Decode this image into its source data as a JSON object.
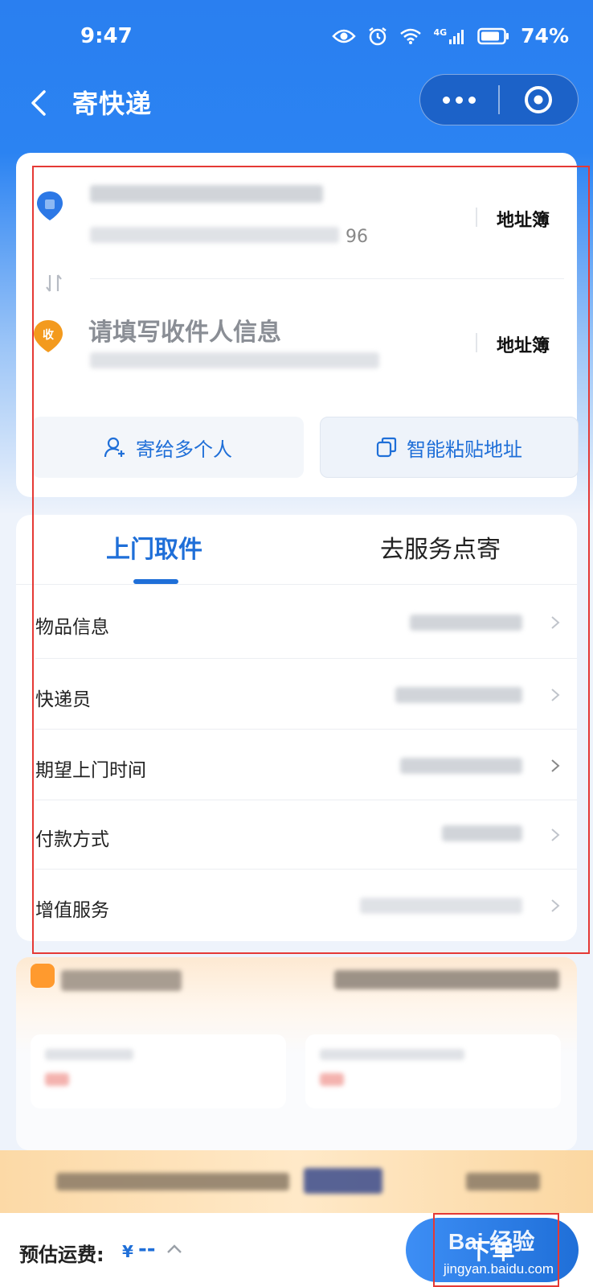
{
  "status_bar": {
    "time": "9:47",
    "network": "4G",
    "battery": "74%"
  },
  "header": {
    "title": "寄快递"
  },
  "sender": {
    "number_suffix": "96",
    "address_book_label": "地址簿"
  },
  "receiver": {
    "placeholder": "请填写收件人信息",
    "badge": "收",
    "address_book_label": "地址簿"
  },
  "actions": {
    "multi_send_label": "寄给多个人",
    "smart_paste_label": "智能粘贴地址"
  },
  "tabs": [
    {
      "label": "上门取件",
      "active": true
    },
    {
      "label": "去服务点寄",
      "active": false
    }
  ],
  "rows": [
    {
      "label": "物品信息"
    },
    {
      "label": "快递员"
    },
    {
      "label": "期望上门时间"
    },
    {
      "label": "付款方式"
    },
    {
      "label": "增值服务"
    }
  ],
  "bottom": {
    "fee_label": "预估运费:",
    "currency": "¥",
    "fee_value": "--",
    "order_label": "下单"
  },
  "watermark": {
    "brand": "Bai 经验",
    "url": "jingyan.baidu.com"
  },
  "colors": {
    "primary": "#1f6fd8",
    "header_bg": "#2b83f2",
    "highlight": "#e53935",
    "receiver_badge": "#f39a1e"
  }
}
